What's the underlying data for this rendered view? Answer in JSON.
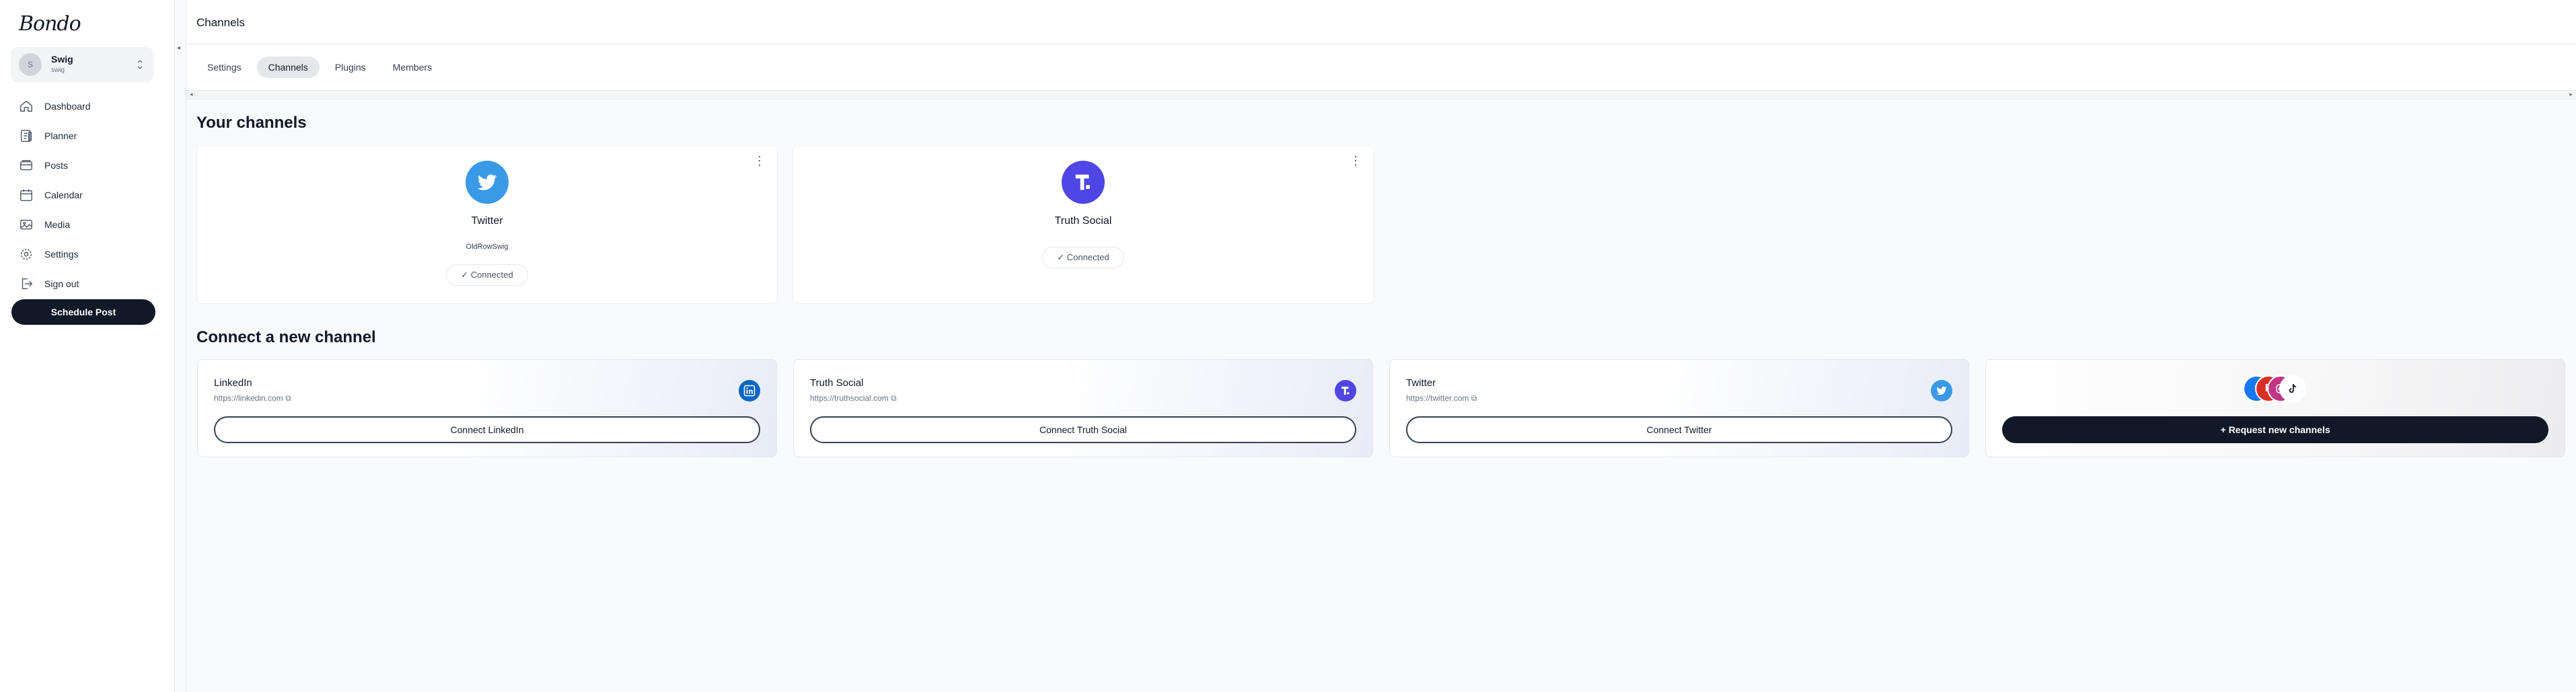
{
  "app": {
    "logo": "Bondo"
  },
  "account": {
    "initial": "S",
    "name": "Swig",
    "sub": "swig"
  },
  "sidebar": {
    "items": [
      {
        "label": "Dashboard",
        "icon": "home-icon"
      },
      {
        "label": "Planner",
        "icon": "planner-icon"
      },
      {
        "label": "Posts",
        "icon": "posts-icon"
      },
      {
        "label": "Calendar",
        "icon": "calendar-icon"
      },
      {
        "label": "Media",
        "icon": "media-icon"
      },
      {
        "label": "Settings",
        "icon": "gear-icon"
      },
      {
        "label": "Sign out",
        "icon": "sign-out-icon"
      }
    ],
    "schedule_label": "Schedule Post"
  },
  "header": {
    "title": "Channels"
  },
  "tabs": [
    {
      "label": "Settings",
      "active": false
    },
    {
      "label": "Channels",
      "active": true
    },
    {
      "label": "Plugins",
      "active": false
    },
    {
      "label": "Members",
      "active": false
    }
  ],
  "your_channels": {
    "title": "Your channels",
    "items": [
      {
        "name": "Twitter",
        "username": "OldRowSwig",
        "status": "✓ Connected",
        "logo": "twitter-bird-icon",
        "color": "#3b9ae8"
      },
      {
        "name": "Truth Social",
        "username": "",
        "status": "✓ Connected",
        "logo": "truth-social-icon",
        "color": "#4f46e5"
      }
    ]
  },
  "connect": {
    "title": "Connect a new channel",
    "items": [
      {
        "name": "LinkedIn",
        "url": "https://linkedin.com",
        "button": "Connect LinkedIn",
        "icon": "linkedin-icon",
        "color": "#0a66c2"
      },
      {
        "name": "Truth Social",
        "url": "https://truthsocial.com",
        "button": "Connect Truth Social",
        "icon": "truth-social-icon",
        "color": "#4f46e5"
      },
      {
        "name": "Twitter",
        "url": "https://twitter.com",
        "button": "Connect Twitter",
        "icon": "twitter-bird-icon",
        "color": "#3b9ae8"
      }
    ],
    "request_button": "+ Request new channels"
  },
  "external_link_glyph": "⧉"
}
